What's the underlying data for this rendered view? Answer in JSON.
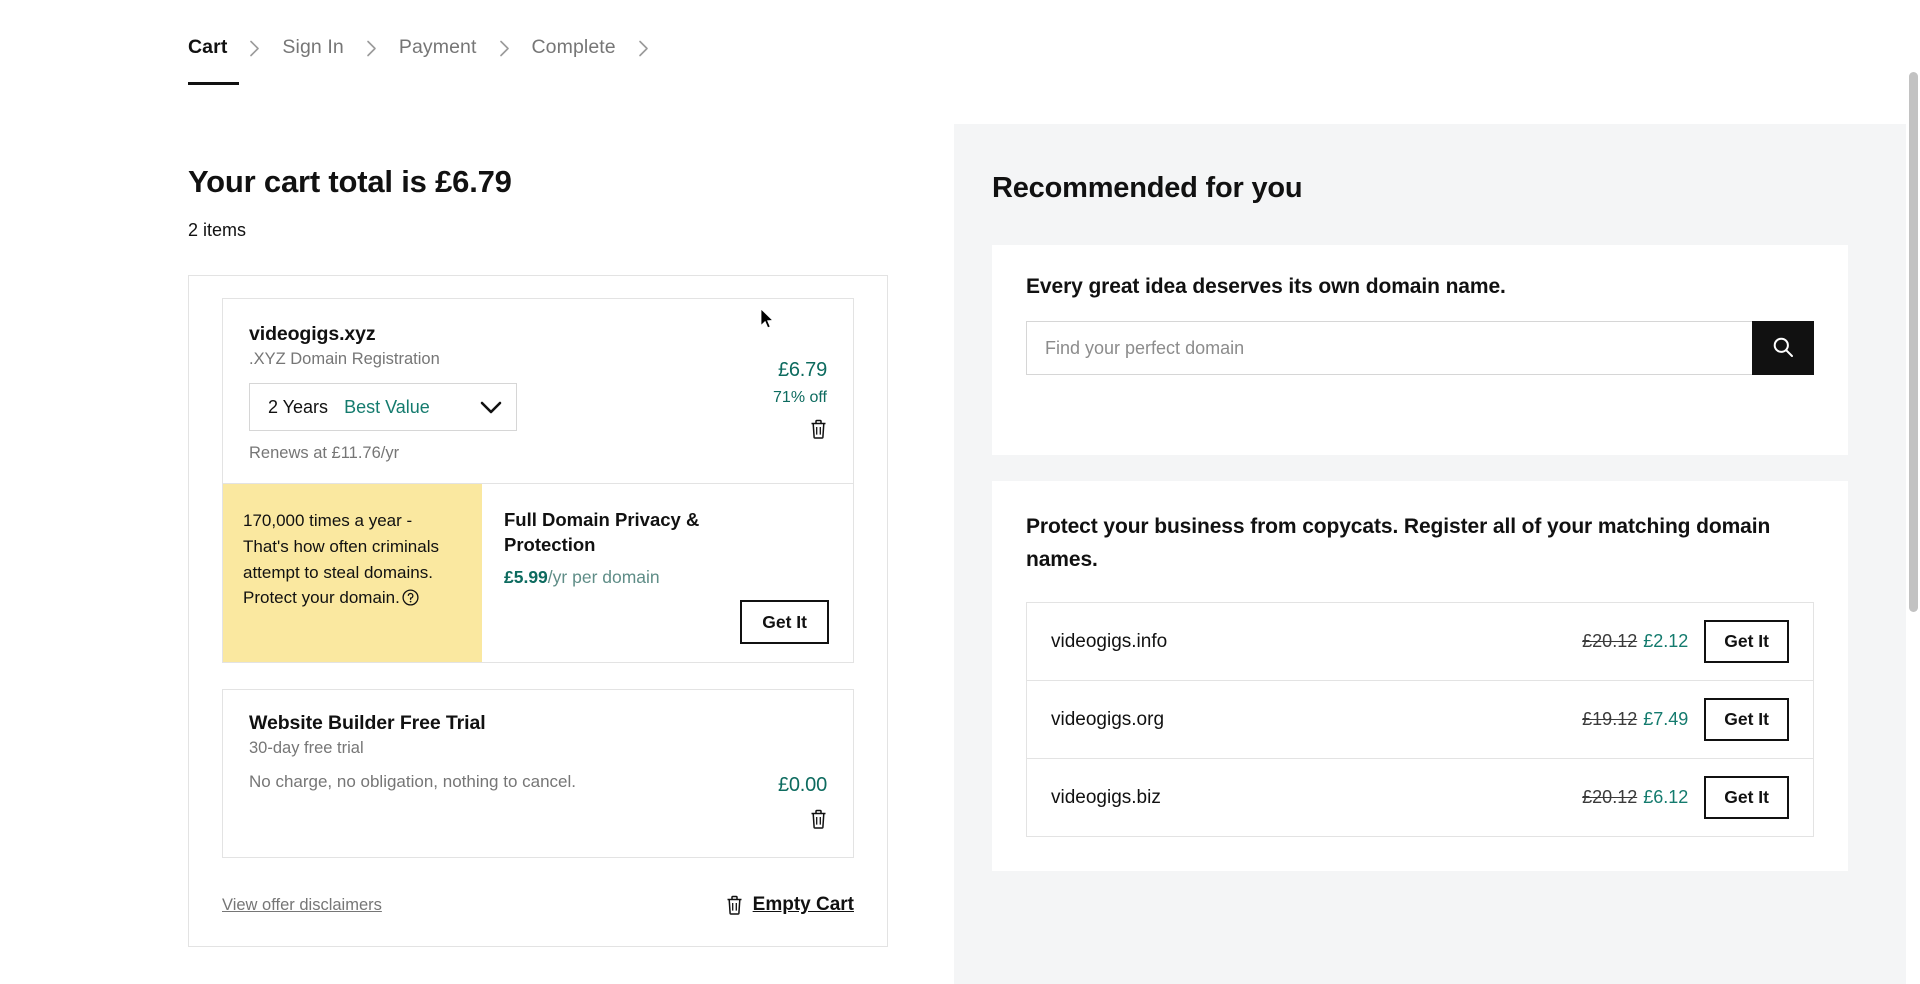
{
  "checkout_steps": [
    {
      "label": "Cart",
      "active": true
    },
    {
      "label": "Sign In",
      "active": false
    },
    {
      "label": "Payment",
      "active": false
    },
    {
      "label": "Complete",
      "active": false
    }
  ],
  "cart": {
    "total_heading": "Your cart total is £6.79",
    "items_count_label": "2 items",
    "items": [
      {
        "title": "videogigs.xyz",
        "subtitle": ".XYZ Domain Registration",
        "term_years": "2 Years",
        "term_badge": "Best Value",
        "renews_text": "Renews at £11.76/yr",
        "price": "£6.79",
        "discount": "71% off"
      },
      {
        "title": "Website Builder Free Trial",
        "subtitle": "30-day free trial",
        "note": "No charge, no obligation, nothing to cancel.",
        "price": "£0.00"
      }
    ],
    "promo": {
      "yellow_text": "170,000 times a year - That's how often criminals attempt to steal domains. Protect your domain.",
      "offer_title": "Full Domain Privacy & Protection",
      "offer_price": "£5.99",
      "offer_price_suffix": "/yr per domain",
      "offer_cta": "Get It"
    },
    "footer": {
      "disclaimers_link": "View offer disclaimers",
      "empty_cart_label": "Empty Cart"
    }
  },
  "recommended": {
    "heading": "Recommended for you",
    "search_card": {
      "title": "Every great idea deserves its own domain name.",
      "input_value": "",
      "input_placeholder": "Find your perfect domain"
    },
    "copycats_card": {
      "title": "Protect your business from copycats. Register all of your matching domain names.",
      "rows": [
        {
          "domain": "videogigs.info",
          "old_price": "£20.12",
          "new_price": "£2.12",
          "cta": "Get It"
        },
        {
          "domain": "videogigs.org",
          "old_price": "£19.12",
          "new_price": "£7.49",
          "cta": "Get It"
        },
        {
          "domain": "videogigs.biz",
          "old_price": "£20.12",
          "new_price": "£6.12",
          "cta": "Get It"
        }
      ]
    }
  },
  "colors": {
    "accent_teal": "#147b6e",
    "promo_yellow": "#fae8a0",
    "panel_gray": "#f4f5f6",
    "text_dark": "#111111"
  }
}
